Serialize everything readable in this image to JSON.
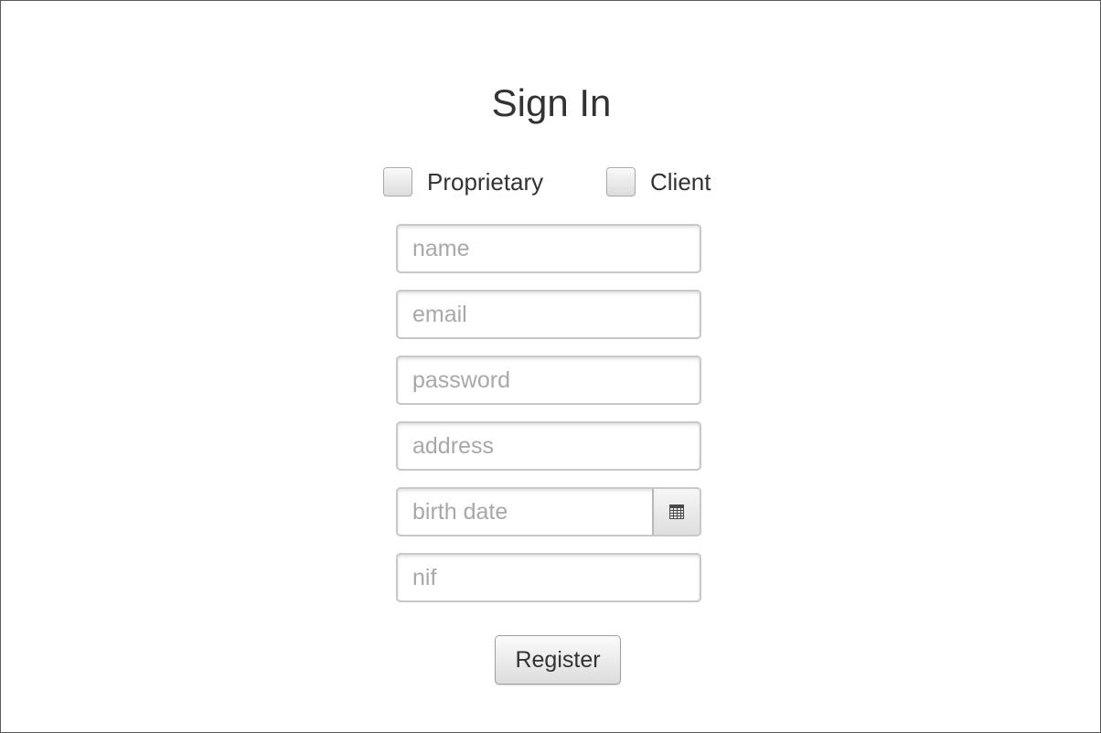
{
  "form": {
    "title": "Sign In",
    "roles": [
      {
        "label": "Proprietary",
        "checked": false
      },
      {
        "label": "Client",
        "checked": false
      }
    ],
    "fields": {
      "name": {
        "placeholder": "name",
        "value": ""
      },
      "email": {
        "placeholder": "email",
        "value": ""
      },
      "password": {
        "placeholder": "password",
        "value": ""
      },
      "address": {
        "placeholder": "address",
        "value": ""
      },
      "birth_date": {
        "placeholder": "birth date",
        "value": ""
      },
      "nif": {
        "placeholder": "nif",
        "value": ""
      }
    },
    "date_picker_icon": "calendar-icon",
    "submit_label": "Register"
  }
}
